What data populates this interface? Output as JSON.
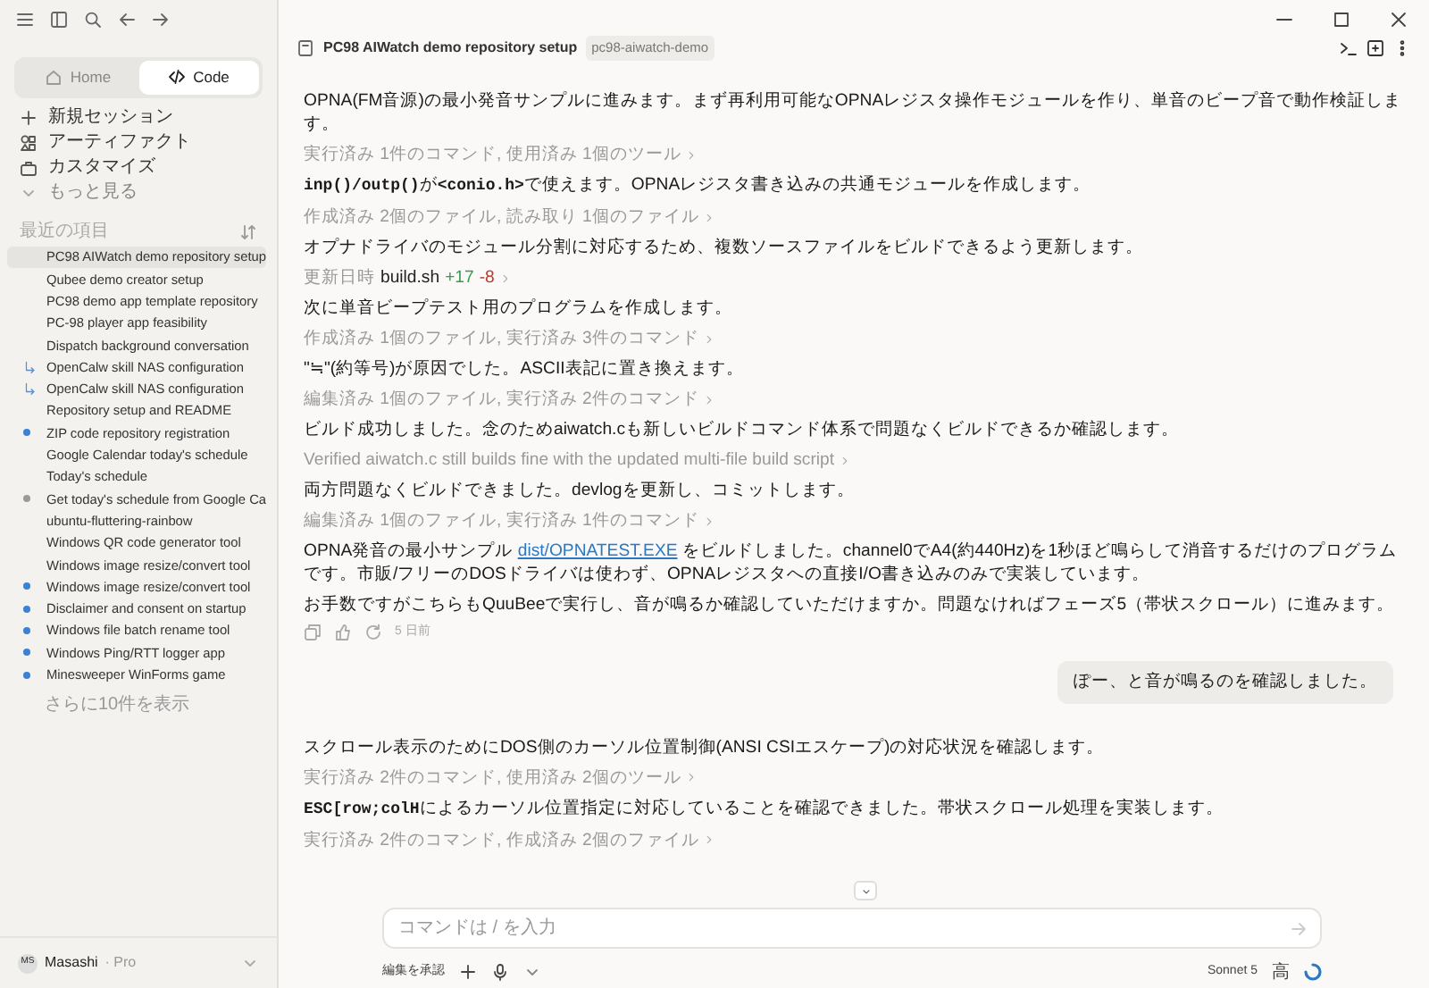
{
  "sidebar": {
    "tabs": [
      {
        "label": "Home",
        "selected": false
      },
      {
        "label": "Code",
        "selected": true
      }
    ],
    "menu": [
      {
        "label": "新規セッション",
        "kind": "new"
      },
      {
        "label": "アーティファクト",
        "kind": "artifacts"
      },
      {
        "label": "カスタマイズ",
        "kind": "customize"
      },
      {
        "label": "もっと見る",
        "kind": "more"
      }
    ],
    "section_label": "最近の項目",
    "recents": [
      {
        "label": "PC98 AIWatch demo repository setup",
        "kind": "plain",
        "selected": true
      },
      {
        "label": "Qubee demo creator setup",
        "kind": "plain",
        "selected": false
      },
      {
        "label": "PC98 demo app template repository",
        "kind": "plain",
        "selected": false
      },
      {
        "label": "PC-98 player app feasibility",
        "kind": "plain",
        "selected": false
      },
      {
        "label": "Dispatch background conversation",
        "kind": "plain",
        "selected": false
      },
      {
        "label": "OpenCalw skill NAS configuration",
        "kind": "branch",
        "selected": false
      },
      {
        "label": "OpenCalw skill NAS configuration",
        "kind": "branch",
        "selected": false
      },
      {
        "label": "Repository setup and README",
        "kind": "plain",
        "selected": false
      },
      {
        "label": "ZIP code repository registration",
        "kind": "dot",
        "color": "#3b82d6",
        "selected": false
      },
      {
        "label": "Google Calendar today's schedule",
        "kind": "plain",
        "selected": false
      },
      {
        "label": "Today's schedule",
        "kind": "plain",
        "selected": false
      },
      {
        "label": "Get today's schedule from Google Ca",
        "kind": "dot",
        "color": "#9a9a9a",
        "selected": false
      },
      {
        "label": "ubuntu-fluttering-rainbow",
        "kind": "plain",
        "selected": false
      },
      {
        "label": "Windows QR code generator tool",
        "kind": "plain",
        "selected": false
      },
      {
        "label": "Windows image resize/convert tool",
        "kind": "plain",
        "selected": false
      },
      {
        "label": "Windows image resize/convert tool",
        "kind": "dot",
        "color": "#3b82d6",
        "selected": false
      },
      {
        "label": "Disclaimer and consent on startup",
        "kind": "dot",
        "color": "#3b82d6",
        "selected": false
      },
      {
        "label": "Windows file batch rename tool",
        "kind": "dot",
        "color": "#3b82d6",
        "selected": false
      },
      {
        "label": "Windows Ping/RTT logger app",
        "kind": "dot",
        "color": "#3b82d6",
        "selected": false
      },
      {
        "label": "Minesweeper WinForms game",
        "kind": "dot",
        "color": "#3b82d6",
        "selected": false
      }
    ],
    "show_more": "さらに10件を表示",
    "user": {
      "initials": "MS",
      "name": "Masashi",
      "plan": "· Pro"
    }
  },
  "header": {
    "title": "PC98 AIWatch demo repository setup",
    "tag": "pc98-aiwatch-demo"
  },
  "messages": [
    {
      "kind": "text",
      "parts": [
        {
          "kind": "plain",
          "text": "OPNA(FM音源)の最小発音サンプルに進みます。まず再利用可能なOPNAレジスタ操作モジュールを作り、単音のビープ音で動作検証します。"
        }
      ]
    },
    {
      "kind": "tool",
      "text": "実行済み 1件のコマンド, 使用済み 1個のツール"
    },
    {
      "kind": "text",
      "parts": [
        {
          "kind": "code",
          "text": "inp()/outp()"
        },
        {
          "kind": "plain",
          "text": "が"
        },
        {
          "kind": "code",
          "text": "<conio.h>"
        },
        {
          "kind": "plain",
          "text": "で使えます。OPNAレジスタ書き込みの共通モジュールを作成します。"
        }
      ]
    },
    {
      "kind": "tool",
      "text": "作成済み 2個のファイル, 読み取り 1個のファイル"
    },
    {
      "kind": "text",
      "parts": [
        {
          "kind": "plain",
          "text": "オプナドライバのモジュール分割に対応するため、複数ソースファイルをビルドできるよう更新します。"
        }
      ]
    },
    {
      "kind": "edit",
      "label": "更新日時",
      "file": "build.sh",
      "added": "+17",
      "removed": "-8"
    },
    {
      "kind": "text",
      "parts": [
        {
          "kind": "plain",
          "text": "次に単音ビープテスト用のプログラムを作成します。"
        }
      ]
    },
    {
      "kind": "tool",
      "text": "作成済み 1個のファイル, 実行済み 3件のコマンド"
    },
    {
      "kind": "text",
      "parts": [
        {
          "kind": "plain",
          "text": "\"≒\"(約等号)が原因でした。ASCII表記に置き換えます。"
        }
      ]
    },
    {
      "kind": "tool",
      "text": "編集済み 1個のファイル, 実行済み 2件のコマンド"
    },
    {
      "kind": "text",
      "parts": [
        {
          "kind": "plain",
          "text": "ビルド成功しました。念のためaiwatch.cも新しいビルドコマンド体系で問題なくビルドできるか確認します。"
        }
      ]
    },
    {
      "kind": "tool",
      "text": "Verified aiwatch.c still builds fine with the updated multi-file build script"
    },
    {
      "kind": "text",
      "parts": [
        {
          "kind": "plain",
          "text": "両方問題なくビルドできました。devlogを更新し、コミットします。"
        }
      ]
    },
    {
      "kind": "tool",
      "text": "編集済み 1個のファイル, 実行済み 1件のコマンド"
    },
    {
      "kind": "text",
      "parts": [
        {
          "kind": "plain",
          "text": "OPNA発音の最小サンプル "
        },
        {
          "kind": "link",
          "text": "dist/OPNATEST.EXE"
        },
        {
          "kind": "plain",
          "text": " をビルドしました。channel0でA4(約440Hz)を1秒ほど鳴らして消音するだけのプログラムです。市販/フリーのDOSドライバは使わず、OPNAレジスタへの直接I/O書き込みのみで実装しています。"
        }
      ]
    },
    {
      "kind": "text",
      "parts": [
        {
          "kind": "plain",
          "text": "お手数ですがこちらもQuuBeeで実行し、音が鳴るか確認していただけますか。問題なければフェーズ5（帯状スクロール）に進みます。"
        }
      ]
    },
    {
      "kind": "actions",
      "time": "5 日前"
    },
    {
      "kind": "user",
      "text": "ぽー、と音が鳴るのを確認しました。"
    },
    {
      "kind": "text",
      "parts": [
        {
          "kind": "plain",
          "text": "スクロール表示のためにDOS側のカーソル位置制御(ANSI CSIエスケープ)の対応状況を確認します。"
        }
      ]
    },
    {
      "kind": "tool",
      "text": "実行済み 2件のコマンド, 使用済み 2個のツール"
    },
    {
      "kind": "text",
      "parts": [
        {
          "kind": "code",
          "text": "ESC[row;colH"
        },
        {
          "kind": "plain",
          "text": "によるカーソル位置指定に対応していることを確認できました。帯状スクロール処理を実装します。"
        }
      ]
    },
    {
      "kind": "tool",
      "text": "実行済み 2件のコマンド, 作成済み 2個のファイル"
    }
  ],
  "composer": {
    "placeholder": "コマンドは / を入力",
    "approve": "編集を承認",
    "model": "Sonnet 5",
    "effort": "高"
  }
}
